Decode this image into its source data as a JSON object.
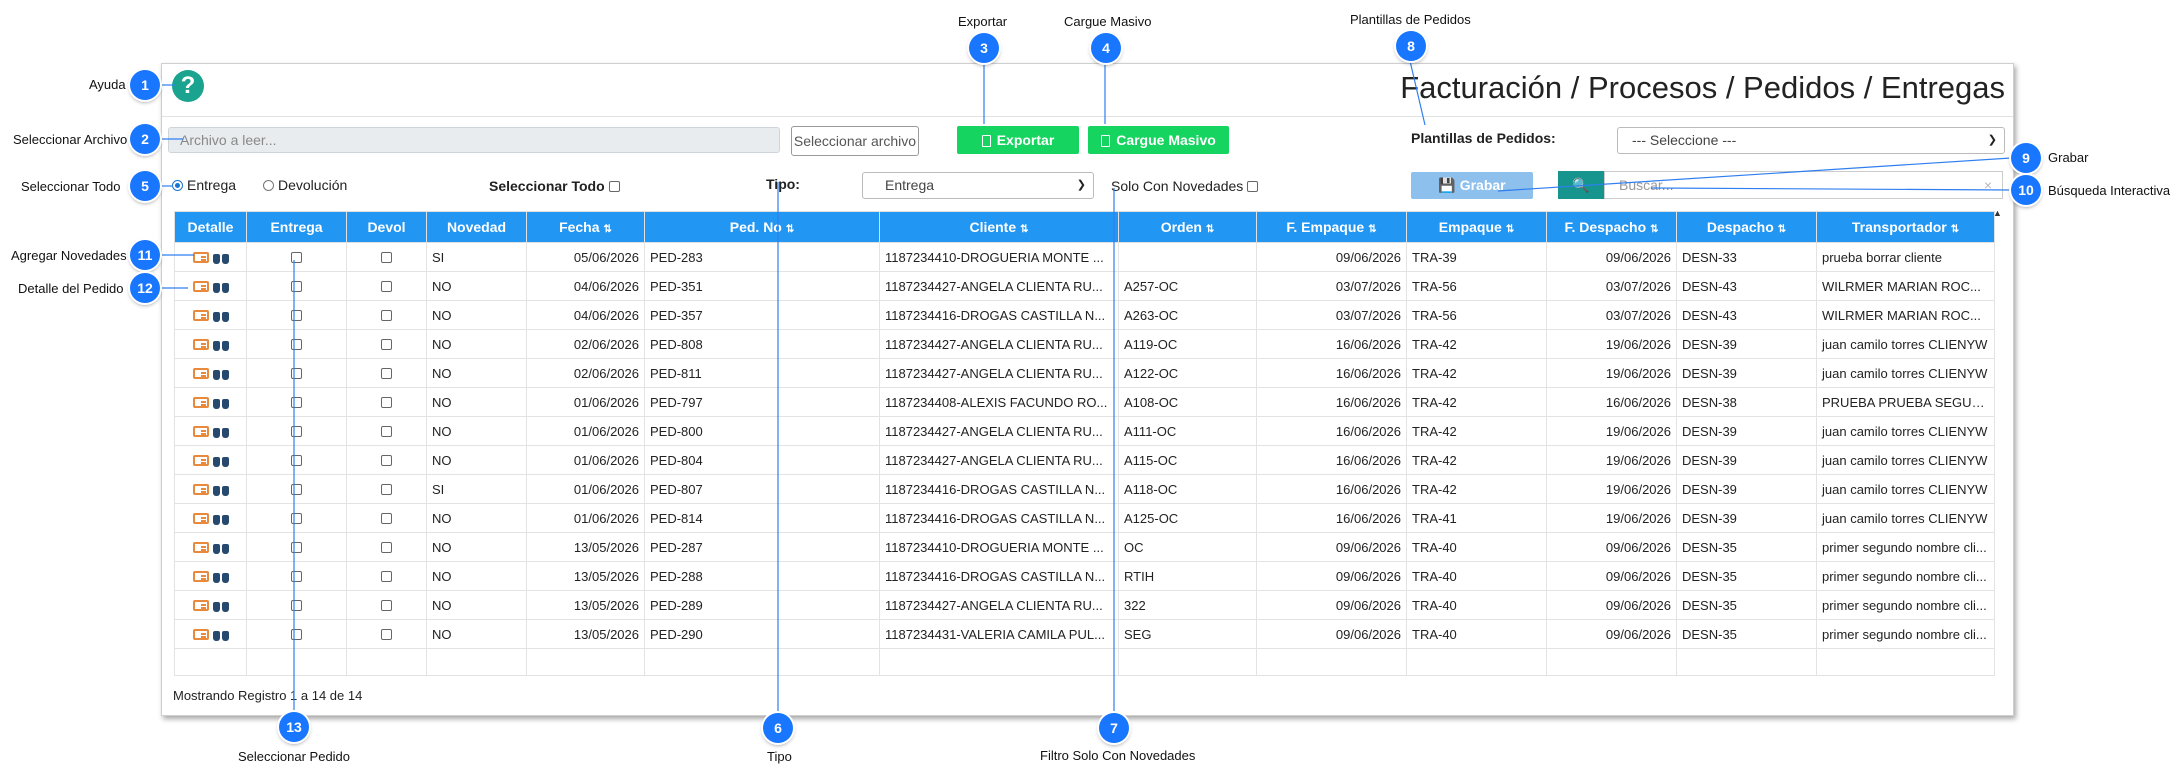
{
  "app": {
    "title": "Facturación / Procesos / Pedidos / Entregas",
    "file_placeholder": "Archivo a leer...",
    "file_button": "Seleccionar archivo",
    "export_label": "Exportar",
    "bulk_label": "Cargue Masivo",
    "templates_label": "Plantillas de Pedidos:",
    "templates_value": "--- Seleccione ---",
    "radio_delivery": "Entrega",
    "radio_return": "Devolución",
    "select_all_label": "Seleccionar Todo",
    "type_label": "Tipo:",
    "type_value": "Entrega",
    "only_news_label": "Solo Con Novedades",
    "save_label": "Grabar",
    "search_placeholder": "Buscar...",
    "footer": "Mostrando Registro 1 a 14 de 14"
  },
  "colors": {
    "primary": "#2196f3",
    "success": "#15d45f",
    "teal": "#16958f",
    "callout": "#1976ff"
  },
  "icons": [
    "question-circle-icon",
    "file-icon",
    "save-icon",
    "search-icon",
    "id-card-icon",
    "binoculars-icon"
  ],
  "table": {
    "headers": [
      "Detalle",
      "Entrega",
      "Devol",
      "Novedad",
      "Fecha",
      "Ped. No",
      "Cliente",
      "Orden",
      "F. Empaque",
      "Empaque",
      "F. Despacho",
      "Despacho",
      "Transportador"
    ],
    "rows": [
      [
        "SI",
        "05/06/2026",
        "PED-283",
        "1187234410-DROGUERIA MONTE ...",
        "",
        "09/06/2026",
        "TRA-39",
        "09/06/2026",
        "DESN-33",
        "prueba borrar cliente"
      ],
      [
        "NO",
        "04/06/2026",
        "PED-351",
        "1187234427-ANGELA CLIENTA RU...",
        "A257-OC",
        "03/07/2026",
        "TRA-56",
        "03/07/2026",
        "DESN-43",
        "WILRMER MARIAN ROC..."
      ],
      [
        "NO",
        "04/06/2026",
        "PED-357",
        "1187234416-DROGAS CASTILLA N...",
        "A263-OC",
        "03/07/2026",
        "TRA-56",
        "03/07/2026",
        "DESN-43",
        "WILRMER MARIAN ROC..."
      ],
      [
        "NO",
        "02/06/2026",
        "PED-808",
        "1187234427-ANGELA CLIENTA RU...",
        "A119-OC",
        "16/06/2026",
        "TRA-42",
        "19/06/2026",
        "DESN-39",
        "juan camilo torres CLIENYW"
      ],
      [
        "NO",
        "02/06/2026",
        "PED-811",
        "1187234427-ANGELA CLIENTA RU...",
        "A122-OC",
        "16/06/2026",
        "TRA-42",
        "19/06/2026",
        "DESN-39",
        "juan camilo torres CLIENYW"
      ],
      [
        "NO",
        "01/06/2026",
        "PED-797",
        "1187234408-ALEXIS FACUNDO RO...",
        "A108-OC",
        "16/06/2026",
        "TRA-42",
        "16/06/2026",
        "DESN-38",
        "PRUEBA PRUEBA SEGUN..."
      ],
      [
        "NO",
        "01/06/2026",
        "PED-800",
        "1187234427-ANGELA CLIENTA RU...",
        "A111-OC",
        "16/06/2026",
        "TRA-42",
        "19/06/2026",
        "DESN-39",
        "juan camilo torres CLIENYW"
      ],
      [
        "NO",
        "01/06/2026",
        "PED-804",
        "1187234427-ANGELA CLIENTA RU...",
        "A115-OC",
        "16/06/2026",
        "TRA-42",
        "19/06/2026",
        "DESN-39",
        "juan camilo torres CLIENYW"
      ],
      [
        "SI",
        "01/06/2026",
        "PED-807",
        "1187234416-DROGAS CASTILLA N...",
        "A118-OC",
        "16/06/2026",
        "TRA-42",
        "19/06/2026",
        "DESN-39",
        "juan camilo torres CLIENYW"
      ],
      [
        "NO",
        "01/06/2026",
        "PED-814",
        "1187234416-DROGAS CASTILLA N...",
        "A125-OC",
        "16/06/2026",
        "TRA-41",
        "19/06/2026",
        "DESN-39",
        "juan camilo torres CLIENYW"
      ],
      [
        "NO",
        "13/05/2026",
        "PED-287",
        "1187234410-DROGUERIA MONTE ...",
        "OC",
        "09/06/2026",
        "TRA-40",
        "09/06/2026",
        "DESN-35",
        "primer segundo nombre cli..."
      ],
      [
        "NO",
        "13/05/2026",
        "PED-288",
        "1187234416-DROGAS CASTILLA N...",
        "RTIH",
        "09/06/2026",
        "TRA-40",
        "09/06/2026",
        "DESN-35",
        "primer segundo nombre cli..."
      ],
      [
        "NO",
        "13/05/2026",
        "PED-289",
        "1187234427-ANGELA CLIENTA RU...",
        "322",
        "09/06/2026",
        "TRA-40",
        "09/06/2026",
        "DESN-35",
        "primer segundo nombre cli..."
      ],
      [
        "NO",
        "13/05/2026",
        "PED-290",
        "1187234431-VALERIA CAMILA PUL...",
        "SEG",
        "09/06/2026",
        "TRA-40",
        "09/06/2026",
        "DESN-35",
        "primer segundo nombre cli..."
      ]
    ]
  },
  "callouts": [
    {
      "n": "1",
      "label": "Ayuda"
    },
    {
      "n": "2",
      "label": "Seleccionar Archivo"
    },
    {
      "n": "3",
      "label": "Exportar"
    },
    {
      "n": "4",
      "label": "Cargue Masivo"
    },
    {
      "n": "5",
      "label": "Seleccionar Todo"
    },
    {
      "n": "6",
      "label": "Tipo"
    },
    {
      "n": "7",
      "label": "Filtro Solo Con Novedades"
    },
    {
      "n": "8",
      "label": "Plantillas de Pedidos"
    },
    {
      "n": "9",
      "label": "Grabar"
    },
    {
      "n": "10",
      "label": "Búsqueda Interactiva"
    },
    {
      "n": "11",
      "label": "Agregar Novedades"
    },
    {
      "n": "12",
      "label": "Detalle del Pedido"
    },
    {
      "n": "13",
      "label": "Seleccionar Pedido"
    }
  ]
}
